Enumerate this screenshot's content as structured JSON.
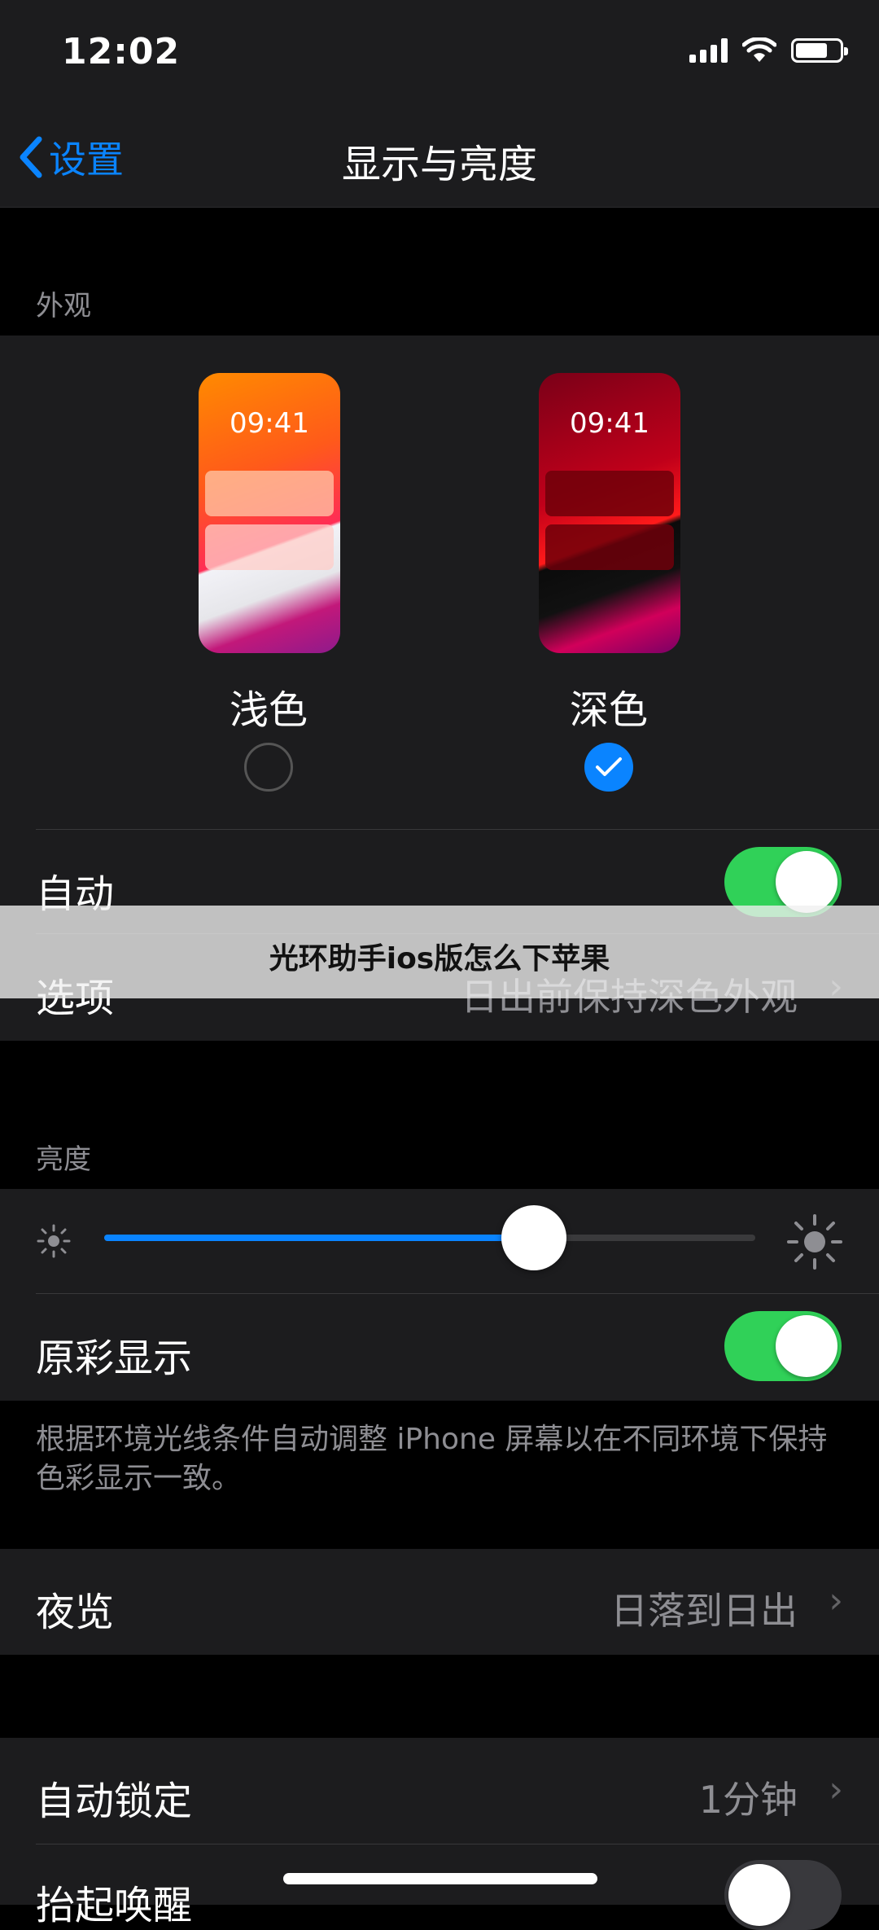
{
  "status_bar": {
    "time": "12:02"
  },
  "nav": {
    "back_label": "设置",
    "title": "显示与亮度"
  },
  "appearance": {
    "section_label": "外观",
    "light": {
      "label": "浅色",
      "preview_time": "09:41"
    },
    "dark": {
      "label": "深色",
      "preview_time": "09:41"
    },
    "auto_label": "自动",
    "options_label": "选项",
    "options_value": "日出前保持深色外观"
  },
  "brightness": {
    "section_label": "亮度",
    "level_percent": 66,
    "true_tone_label": "原彩显示",
    "true_tone_desc": "根据环境光线条件自动调整 iPhone 屏幕以在不同环境下保持色彩显示一致。"
  },
  "night_shift": {
    "label": "夜览",
    "value": "日落到日出"
  },
  "auto_lock": {
    "label": "自动锁定",
    "value": "1分钟"
  },
  "raise_to_wake": {
    "label": "抬起唤醒"
  },
  "banner": {
    "text": "光环助手ios版怎么下苹果"
  },
  "colors": {
    "accent": "#0a84ff",
    "toggle_on": "#30d158",
    "toggle_off": "#39393d"
  }
}
